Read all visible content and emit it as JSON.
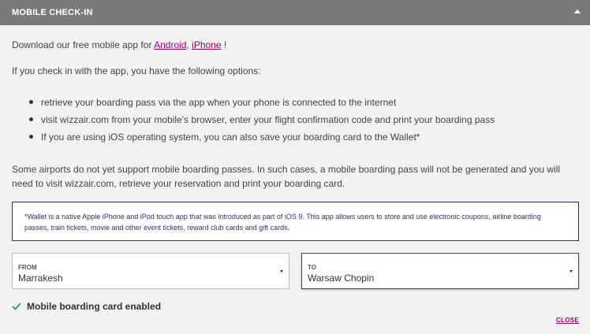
{
  "header": {
    "title": "MOBILE CHECK-IN",
    "toggle_icon": "caret-up-icon"
  },
  "intro": {
    "prefix": "Download our free mobile app for ",
    "android_link": "Android",
    "separator": ", ",
    "iphone_link": "iPhone",
    "suffix": " !"
  },
  "options_intro": "If you check in with the app, you have the following options:",
  "options": [
    "retrieve your boarding pass via the app when your phone is connected to the internet",
    "visit wizzair.com from your mobile's browser, enter your flight confirmation code and print your boarding pass",
    "If you are using iOS operating system, you can also save your boarding card to the Wallet*"
  ],
  "airports_note": "Some airports do not yet support mobile boarding passes. In such cases, a mobile boarding pass will not be generated and you will need to visit wizzair.com, retrieve your reservation and print your boarding card.",
  "wallet_note": "*Wallet is a native Apple iPhone and iPod touch app that was introduced as part of iOS 9. This app allows users to store and use electronic coupons, airline boarding passes, train tickets, movie and other event tickets, reward club cards and gift cards.",
  "from_select": {
    "label": "FROM",
    "value": "Marrakesh"
  },
  "to_select": {
    "label": "TO",
    "value": "Warsaw Chopin"
  },
  "status": {
    "text": "Mobile boarding card enabled",
    "icon": "check-icon",
    "color": "#3aa655"
  },
  "close_label": "CLOSE",
  "colors": {
    "header_bg": "#7a7a7a",
    "accent": "#a30063",
    "navy": "#2a2e7a"
  }
}
